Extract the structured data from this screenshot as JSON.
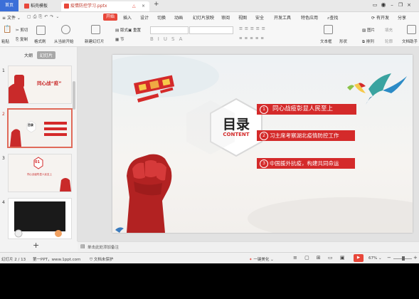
{
  "tabs": {
    "home": "首页",
    "templates": "稻壳模板",
    "doc": "疫情防控学习.pptx"
  },
  "menu": {
    "file": "文件",
    "items": [
      "开始",
      "插入",
      "设计",
      "切换",
      "动画",
      "幻灯片放映",
      "审阅",
      "视图",
      "安全",
      "开发工具",
      "特色应用"
    ],
    "search": "查找",
    "right": [
      "有开发",
      "分享"
    ]
  },
  "ribbon": {
    "cut": "剪切",
    "copy": "复制",
    "format_painter": "格式刷",
    "paste": "粘贴",
    "from_current": "从当前开始",
    "new_slide": "新建幻灯片",
    "layout": "版式",
    "section": "节",
    "reset": "重置",
    "textbox": "文本框",
    "shape": "形状",
    "arrange": "排列",
    "picture": "图片",
    "fill": "填充",
    "outline": "轮廓",
    "text_transform": "文档助手"
  },
  "left_panel": {
    "tab_outline": "大纲",
    "tab_slides": "幻灯片",
    "slides": [
      {
        "num": "1",
        "text": "同心战“疫”"
      },
      {
        "num": "2",
        "text": "目录"
      },
      {
        "num": "3",
        "text": "同心战疫彰显人民至上"
      },
      {
        "num": "4",
        "text": ""
      }
    ]
  },
  "slide": {
    "mulu": "目录",
    "content": "CONTENT",
    "items": [
      {
        "num": "1",
        "label": "同心战疫彰显人民至上"
      },
      {
        "num": "2",
        "label": "习主席考察湖北疫情防控工作"
      },
      {
        "num": "3",
        "label": "中国援外抗疫，构建共同命运"
      }
    ]
  },
  "notes": {
    "placeholder": "单击此处添加备注"
  },
  "status": {
    "slide_count": "幻灯片 2 / 13",
    "theme": "第一PPT，www.1ppt.com",
    "protect": "文档未保护",
    "beautify": "一键美化",
    "zoom": "67%"
  },
  "colors": {
    "accent": "#e8473a",
    "title_red": "#d42a2a",
    "home_tab": "#3b6fd8"
  }
}
